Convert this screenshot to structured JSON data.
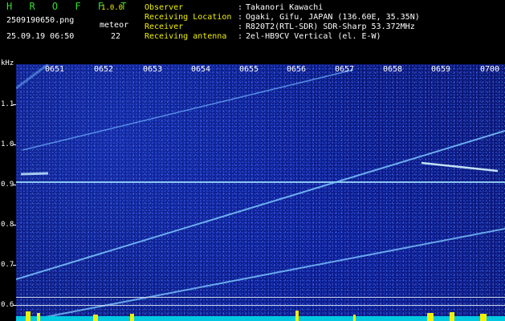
{
  "header": {
    "app_name": "H R O F F T",
    "version": "1.0.0",
    "filename": "2509190650.png",
    "meteor_label": "meteor",
    "meteor_count": "22",
    "datetime": "25.09.19 06:50",
    "fields": [
      {
        "label": "Observer",
        "value": "Takanori Kawachi"
      },
      {
        "label": "Receiving Location",
        "value": "Ogaki, Gifu, JAPAN (136.60E, 35.35N)"
      },
      {
        "label": "Receiver",
        "value": "R820T2(RTL-SDR) SDR-Sharp 53.372MHz"
      },
      {
        "label": "Receiving antenna",
        "value": "2el-HB9CV Vertical (el. E-W)"
      }
    ]
  },
  "spectrogram": {
    "y_unit": "kHz",
    "y_ticks": [
      "1.1",
      "1.0",
      "0.9",
      "0.8",
      "0.7",
      "0.6"
    ],
    "x_ticks": [
      "0651",
      "0652",
      "0653",
      "0654",
      "0655",
      "0656",
      "0657",
      "0658",
      "0659",
      "0700"
    ],
    "colors": {
      "background": "#0b1670",
      "signal": "#8fd8ff",
      "axis": "#ffffff"
    }
  }
}
